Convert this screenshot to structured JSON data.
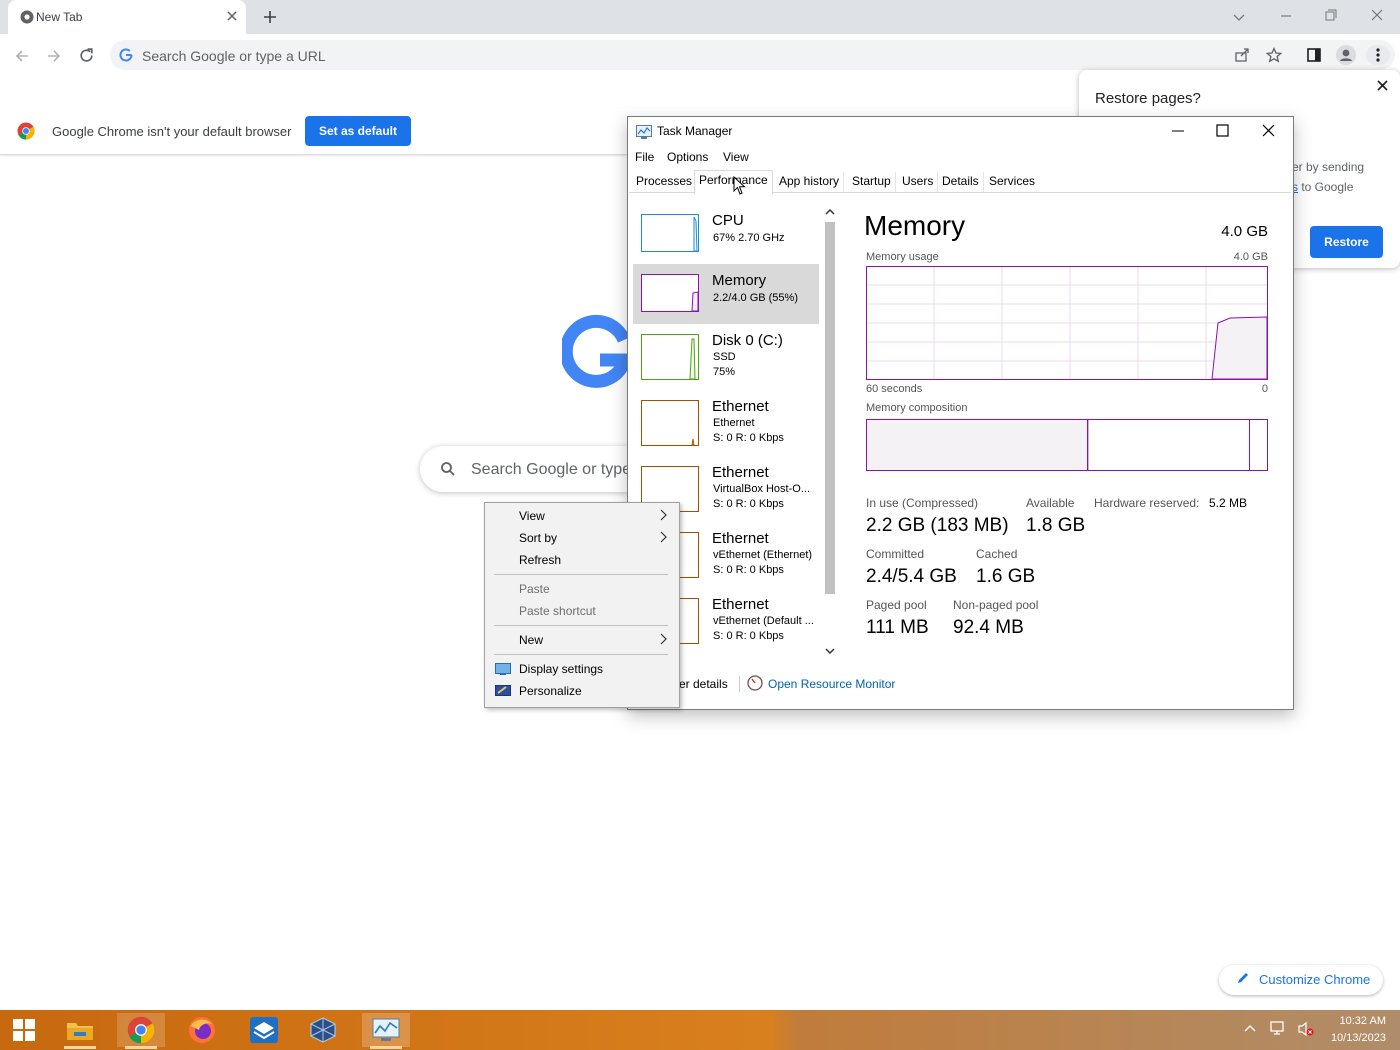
{
  "browser": {
    "tab_title": "New Tab",
    "omnibox_placeholder": "Search Google or type a URL",
    "infobar": {
      "message": "Google Chrome isn't your default browser",
      "set_default_label": "Set as default"
    },
    "restore": {
      "title": "Restore pages?",
      "text_line1": "er by sending",
      "text_link": "s",
      "text_line2": " to Google",
      "button_label": "Restore"
    },
    "google_search_placeholder": "Search Google or type",
    "customize_label": "Customize Chrome"
  },
  "task_manager": {
    "title": "Task Manager",
    "menu": [
      "File",
      "Options",
      "View"
    ],
    "tabs": [
      "Processes",
      "Performance",
      "App history",
      "Startup",
      "Users",
      "Details",
      "Services"
    ],
    "active_tab": "Performance",
    "sidebar": [
      {
        "name": "CPU",
        "sub": [
          "67%  2.70 GHz"
        ],
        "color": "#1b8fd6"
      },
      {
        "name": "Memory",
        "sub": [
          "2.2/4.0 GB (55%)"
        ],
        "color": "#8b12ae"
      },
      {
        "name": "Disk 0 (C:)",
        "sub": [
          "SSD",
          "75%"
        ],
        "color": "#4da60c"
      },
      {
        "name": "Ethernet",
        "sub": [
          "Ethernet",
          "S: 0  R: 0 Kbps"
        ],
        "color": "#a74f01"
      },
      {
        "name": "Ethernet",
        "sub": [
          "VirtualBox Host-O...",
          "S: 0  R: 0 Kbps"
        ],
        "color": "#a74f01"
      },
      {
        "name": "Ethernet",
        "sub": [
          "vEthernet (Ethernet)",
          "S: 0  R: 0 Kbps"
        ],
        "color": "#a74f01"
      },
      {
        "name": "Ethernet",
        "sub": [
          "vEthernet (Default ...",
          "S: 0  R: 0 Kbps"
        ],
        "color": "#a74f01"
      }
    ],
    "detail": {
      "title": "Memory",
      "capacity": "4.0 GB",
      "usage_label": "Memory usage",
      "usage_max": "4.0 GB",
      "time_left": "60 seconds",
      "time_right": "0",
      "composition_label": "Memory composition",
      "usage_fraction": 0.55,
      "stats": {
        "in_use_label": "In use (Compressed)",
        "in_use": "2.2 GB (183 MB)",
        "available_label": "Available",
        "available": "1.8 GB",
        "hw_reserved_label": "Hardware reserved:",
        "hw_reserved": "5.2 MB",
        "committed_label": "Committed",
        "committed": "2.4/5.4 GB",
        "cached_label": "Cached",
        "cached": "1.6 GB",
        "paged_label": "Paged pool",
        "paged": "111 MB",
        "nonpaged_label": "Non-paged pool",
        "nonpaged": "92.4 MB"
      }
    },
    "footer": {
      "fewer_details": "er details",
      "resource_monitor": "Open Resource Monitor"
    }
  },
  "context_menu": {
    "items": [
      "View",
      "Sort by",
      "Refresh",
      "Paste",
      "Paste shortcut",
      "New",
      "Display settings",
      "Personalize"
    ]
  },
  "taskbar": {
    "time": "10:32 AM",
    "date": "10/13/2023"
  },
  "colors": {
    "memory": "#8b12ae",
    "memory_fill": "#f4f2f4",
    "chrome_blue": "#1a73e8"
  }
}
